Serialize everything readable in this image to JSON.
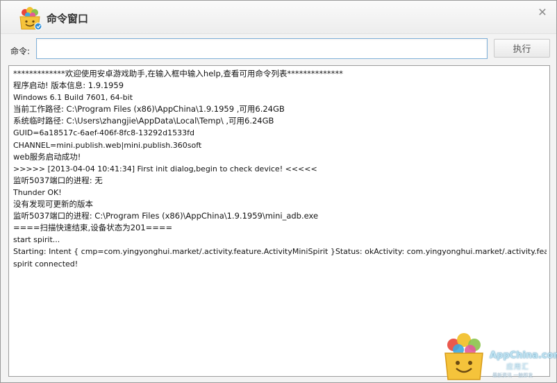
{
  "window": {
    "title": "命令窗口",
    "close_symbol": "✕"
  },
  "command": {
    "label": "命令:",
    "value": "",
    "placeholder": "",
    "execute_label": "执行"
  },
  "log": [
    "*************欢迎使用安卓游戏助手,在输入框中输入help,查看可用命令列表**************",
    "程序启动! 版本信息: 1.9.1959",
    "Windows 6.1 Build 7601, 64-bit",
    "当前工作路径: C:\\Program Files (x86)\\AppChina\\1.9.1959 ,可用6.24GB",
    "系统临时路径: C:\\Users\\zhangjie\\AppData\\Local\\Temp\\ ,可用6.24GB",
    "GUID=6a18517c-6aef-406f-8fc8-13292d1533fd",
    "CHANNEL=mini.publish.web|mini.publish.360soft",
    "web服务启动成功!",
    ">>>>> [2013-04-04 10:41:34] First init dialog,begin to check device! <<<<<",
    "监听5037端口的进程: 无",
    "Thunder OK!",
    "没有发现可更新的版本",
    "监听5037端口的进程: C:\\Program Files (x86)\\AppChina\\1.9.1959\\mini_adb.exe",
    "====扫描快速结束,设备状态为201====",
    "start spirit...",
    "Starting: Intent { cmp=com.yingyonghui.market/.activity.feature.ActivityMiniSpirit }Status: okActivity: com.yingyonghui.market/.activity.feature.Activi...",
    "spirit connected!"
  ],
  "watermark": {
    "brand": "AppChina.com",
    "brand_cn": "应用汇",
    "tagline": "最新资讯 一触即发"
  },
  "colors": {
    "input_border": "#7fb0d8",
    "title_text": "#333333"
  }
}
